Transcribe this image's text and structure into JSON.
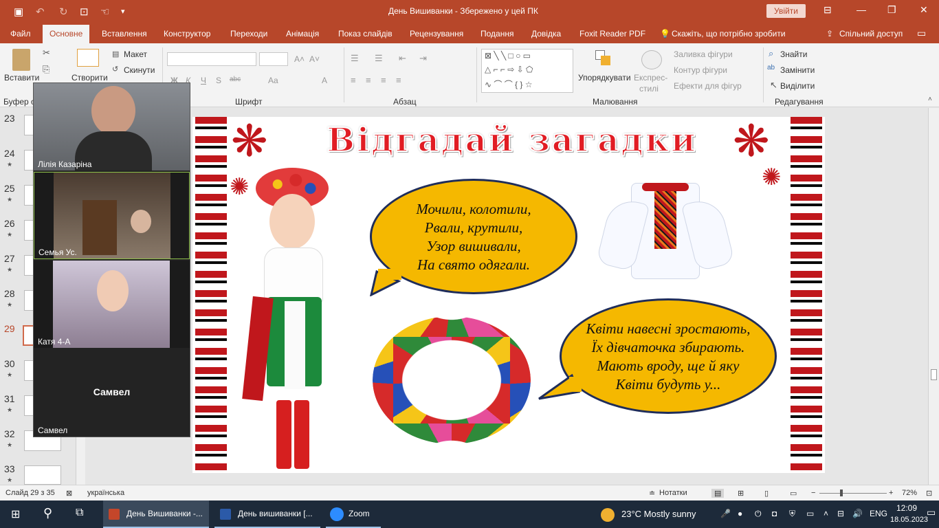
{
  "titlebar": {
    "doc_title": "День Вишиванки  -  Збережено у цей ПК",
    "signin": "Увійти",
    "save_icon": "save-icon",
    "undo_icon": "undo-icon"
  },
  "tabs": [
    "Файл",
    "Основне",
    "Вставлення",
    "Конструктор",
    "Переходи",
    "Анімація",
    "Показ слайдів",
    "Рецензування",
    "Подання",
    "Довідка",
    "Foxit Reader PDF",
    "Скажіть, що потрібно зробити",
    "Спільний доступ"
  ],
  "ribbon": {
    "paste": "Вставити",
    "create": "Створити",
    "layout": "Макет",
    "reset": "Скинути",
    "groups": {
      "clipboard": "Буфер о",
      "font": "Шрифт",
      "paragraph": "Абзац",
      "drawing": "Малювання",
      "editing": "Редагування"
    },
    "arrange": "Упорядкувати",
    "quick_styles": [
      "Експрес-",
      "стилі"
    ],
    "shape_fill": "Заливка фігури",
    "shape_outline": "Контур фігури",
    "shape_effects": "Ефекти для фігур",
    "find": "Знайти",
    "replace": "Замінити",
    "select": "Виділити",
    "format_letters": [
      "Ж",
      "К",
      "Ч",
      "S",
      "abc",
      "Aa",
      "A"
    ]
  },
  "slides_panel": [
    {
      "num": "23"
    },
    {
      "num": "24"
    },
    {
      "num": "25"
    },
    {
      "num": "26"
    },
    {
      "num": "27"
    },
    {
      "num": "28"
    },
    {
      "num": "29"
    },
    {
      "num": "30"
    },
    {
      "num": "31"
    },
    {
      "num": "32"
    },
    {
      "num": "33"
    }
  ],
  "slide": {
    "title": "Відгадай   загадки",
    "riddle1": [
      "Мочили, колотили,",
      "Рвали, крутили,",
      "Узор вишивали,",
      "На свято одягали."
    ],
    "riddle2": [
      "Квіти навесні зростають,",
      "Їх дівчаточка збирають.",
      "Мають вроду, ще й яку",
      "Квіти будуть у..."
    ]
  },
  "zoom": {
    "participants": [
      "Лілія Казаріна",
      "Семья Ус.",
      "Катя  4-А",
      "Самвел"
    ],
    "center_name": "Самвел"
  },
  "statusbar": {
    "slide_info": "Слайд 29 з 35",
    "language": "українська",
    "notes": "Нотатки",
    "zoom": "72%"
  },
  "taskbar": {
    "apps": [
      "День Вишиванки -...",
      "День вишиванки [...",
      "Zoom"
    ],
    "weather": "23°C  Mostly sunny",
    "lang": "ENG",
    "time": "12:09",
    "date": "18.05.2023"
  },
  "colors": {
    "accent": "#b7472a",
    "bubble": "#f5b800",
    "title_red": "#e11d24"
  }
}
